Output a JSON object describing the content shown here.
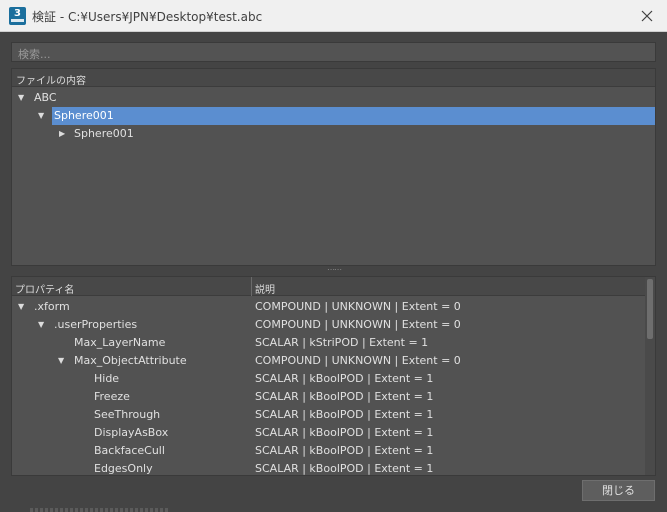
{
  "window": {
    "title": "検証 - C:¥Users¥JPN¥Desktop¥test.abc",
    "app_icon_label": "3"
  },
  "search": {
    "placeholder": "検索..."
  },
  "contents_panel": {
    "header": "ファイルの内容",
    "tree": [
      {
        "label": "ABC",
        "expanded": true,
        "selected": false
      },
      {
        "label": "Sphere001",
        "expanded": true,
        "selected": true
      },
      {
        "label": "Sphere001",
        "expanded": false,
        "selected": false
      }
    ]
  },
  "properties_panel": {
    "columns": [
      "プロパティ名",
      "説明"
    ],
    "rows": [
      {
        "name": ".xform",
        "description": "COMPOUND | UNKNOWN | Extent = 0",
        "arrow": "expanded"
      },
      {
        "name": ".userProperties",
        "description": "COMPOUND | UNKNOWN | Extent = 0",
        "arrow": "expanded"
      },
      {
        "name": "Max_LayerName",
        "description": "SCALAR | kStriPOD | Extent = 1",
        "arrow": "none"
      },
      {
        "name": "Max_ObjectAttribute",
        "description": "COMPOUND | UNKNOWN | Extent = 0",
        "arrow": "expanded"
      },
      {
        "name": "Hide",
        "description": "SCALAR | kBoolPOD | Extent = 1",
        "arrow": "none"
      },
      {
        "name": "Freeze",
        "description": "SCALAR | kBoolPOD | Extent = 1",
        "arrow": "none"
      },
      {
        "name": "SeeThrough",
        "description": "SCALAR | kBoolPOD | Extent = 1",
        "arrow": "none"
      },
      {
        "name": "DisplayAsBox",
        "description": "SCALAR | kBoolPOD | Extent = 1",
        "arrow": "none"
      },
      {
        "name": "BackfaceCull",
        "description": "SCALAR | kBoolPOD | Extent = 1",
        "arrow": "none"
      },
      {
        "name": "EdgesOnly",
        "description": "SCALAR | kBoolPOD | Extent = 1",
        "arrow": "none"
      }
    ]
  },
  "footer": {
    "close_label": "閉じる"
  },
  "colors": {
    "selection": "#5b8ed0",
    "background": "#444444",
    "app_icon": "#1b6f9d"
  }
}
